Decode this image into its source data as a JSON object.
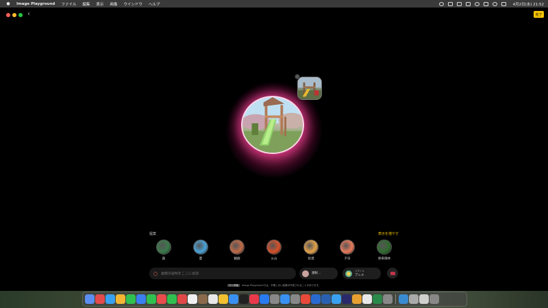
{
  "menubar": {
    "app_name": "Image Playground",
    "menus": [
      "ファイル",
      "編集",
      "表示",
      "画像",
      "ウインドウ",
      "ヘルプ"
    ],
    "clock": "4月2日(水) 21:52"
  },
  "window": {
    "done_label": "完了"
  },
  "suggestions": {
    "title": "提案",
    "show_more": "表示を増やす",
    "items": [
      {
        "label": "森",
        "color": "#3a7a4a"
      },
      {
        "label": "夏",
        "color": "#4aa3d8"
      },
      {
        "label": "観劇",
        "color": "#c26b48"
      },
      {
        "label": "火山",
        "color": "#d8502a"
      },
      {
        "label": "砂漠",
        "color": "#e4a24a"
      },
      {
        "label": "夕日",
        "color": "#e87a5a"
      },
      {
        "label": "熱帯雨林",
        "color": "#2f6b2f"
      }
    ]
  },
  "prompt": {
    "placeholder": "画像の説明をここに追加"
  },
  "person_pill": {
    "label": "選択..."
  },
  "style_pill": {
    "caption": "スタイル",
    "label": "アニメ"
  },
  "footnote": {
    "tag": "ベータ版",
    "text": "Image Playgroundでは、予期しない結果が作成されることがあります。"
  },
  "dock_colors": [
    "#5b8ef0",
    "#e24b4b",
    "#3aa0f0",
    "#f2b634",
    "#30c050",
    "#3a7ef0",
    "#30c050",
    "#e94c4c",
    "#30c050",
    "#e04848",
    "#f0f0f0",
    "#8a6a4a",
    "#e8e8e8",
    "#f0c030",
    "#3a90f0",
    "#222222",
    "#e83a4a",
    "#2a7af0",
    "#888888",
    "#3a90f0",
    "#888888",
    "#e84a3a",
    "#2a6ad0",
    "#2a60b0",
    "#3aa0f0",
    "#2a2a6a",
    "#e8a030",
    "#e8e8e8",
    "#2a8a4a",
    "#888888",
    "#3a8ad0",
    "#aaaaaa",
    "#d0d0d0",
    "#888888"
  ]
}
